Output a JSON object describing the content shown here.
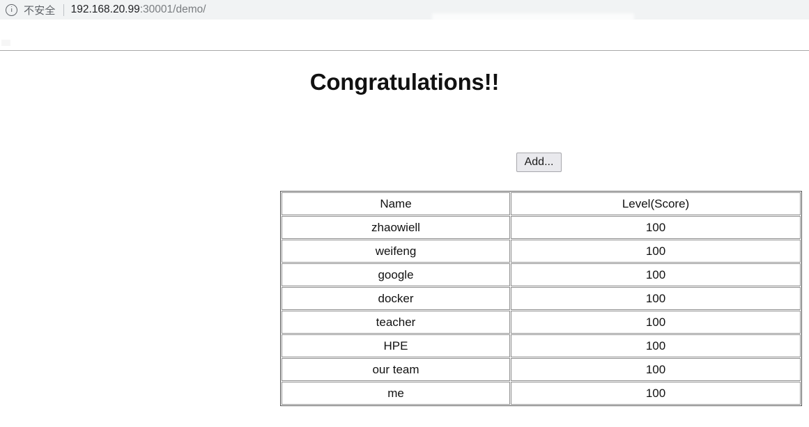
{
  "browser": {
    "security_icon": "info-circle-icon",
    "security_label": "不安全",
    "url_host": "192.168.20.99",
    "url_rest": ":30001/demo/",
    "chrome_bg": "#f1f3f4",
    "security_text_color": "#5f6368",
    "url_host_color": "#202124",
    "url_rest_color": "#7a7d80"
  },
  "page": {
    "title": "Congratulations!!",
    "add_button_label": "Add...",
    "table": {
      "headers": [
        "Name",
        "Level(Score)"
      ],
      "rows": [
        {
          "name": "zhaowiell",
          "score": "100"
        },
        {
          "name": "weifeng",
          "score": "100"
        },
        {
          "name": "google",
          "score": "100"
        },
        {
          "name": "docker",
          "score": "100"
        },
        {
          "name": "teacher",
          "score": "100"
        },
        {
          "name": "HPE",
          "score": "100"
        },
        {
          "name": "our team",
          "score": "100"
        },
        {
          "name": "me",
          "score": "100"
        }
      ]
    }
  }
}
